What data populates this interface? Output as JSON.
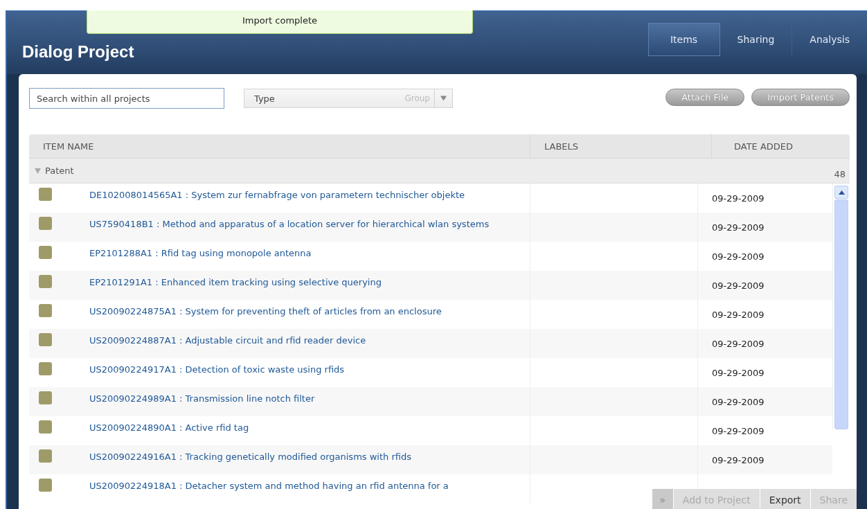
{
  "notification": "Import complete",
  "title": "Dialog Project",
  "tabs": [
    {
      "label": "Items",
      "selected": true
    },
    {
      "label": "Sharing",
      "selected": false
    },
    {
      "label": "Analysis",
      "selected": false
    }
  ],
  "search": {
    "placeholder": "Search within all projects"
  },
  "type_select": {
    "value": "Type",
    "group_label": "Group"
  },
  "buttons": [
    "Attach File",
    "Import Patents"
  ],
  "table": {
    "columns": [
      "ITEM NAME",
      "LABELS",
      "DATE ADDED"
    ],
    "group": {
      "name": "Patent",
      "count": "48",
      "expanded": true
    },
    "rows": [
      {
        "name": "DE102008014565A1 : System zur fernabfrage von parametern technischer objekte",
        "date": "09-29-2009"
      },
      {
        "name": "US7590418B1 : Method and apparatus of a location server for hierarchical wlan systems",
        "date": "09-29-2009"
      },
      {
        "name": "EP2101288A1 : Rfid tag using monopole antenna",
        "date": "09-29-2009"
      },
      {
        "name": "EP2101291A1 : Enhanced item tracking using selective querying",
        "date": "09-29-2009"
      },
      {
        "name": "US20090224875A1 : System for preventing theft of articles from an enclosure",
        "date": "09-29-2009"
      },
      {
        "name": "US20090224887A1 : Adjustable circuit and rfid reader device",
        "date": "09-29-2009"
      },
      {
        "name": "US20090224917A1 : Detection of toxic waste using rfids",
        "date": "09-29-2009"
      },
      {
        "name": "US20090224989A1 : Transmission line notch filter",
        "date": "09-29-2009"
      },
      {
        "name": "US20090224890A1 : Active rfid tag",
        "date": "09-29-2009"
      },
      {
        "name": "US20090224916A1 : Tracking genetically modified organisms with rfids",
        "date": "09-29-2009"
      },
      {
        "name": "US20090224918A1 : Detacher system and method having an rfid antenna for a"
      }
    ]
  },
  "action_bar": {
    "expand": "»",
    "actions": [
      {
        "label": "Add to Project",
        "disabled": true
      },
      {
        "label": "Export",
        "disabled": false
      },
      {
        "label": "Share",
        "disabled": true
      }
    ]
  }
}
